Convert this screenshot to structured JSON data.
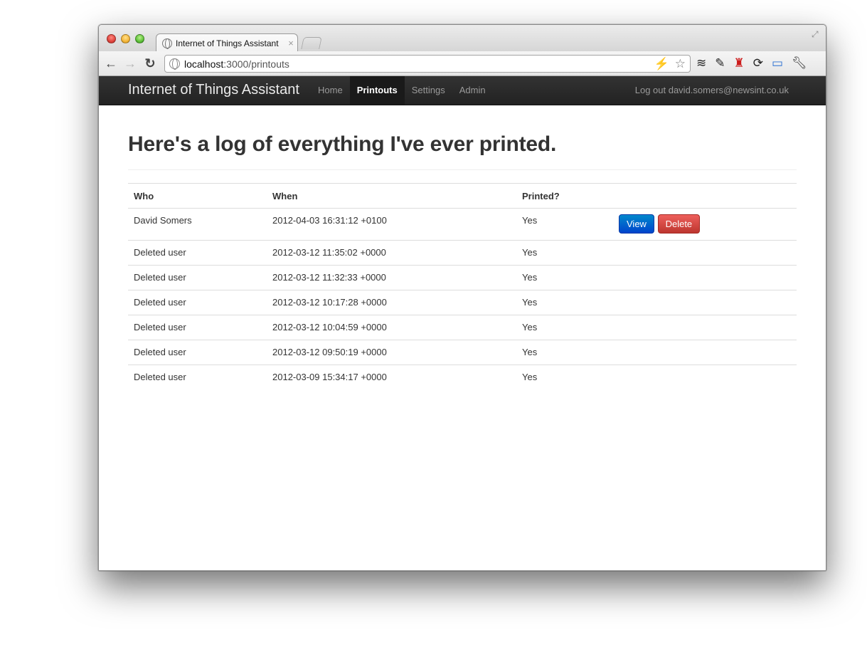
{
  "browser": {
    "tab_title": "Internet of Things Assistant",
    "tab_close": "×",
    "url_host": "localhost",
    "url_rest": ":3000/printouts"
  },
  "nav": {
    "brand": "Internet of Things Assistant",
    "links": [
      "Home",
      "Printouts",
      "Settings",
      "Admin"
    ],
    "active": "Printouts",
    "account": "Log out david.somers@newsint.co.uk"
  },
  "main": {
    "title": "Here's a log of everything I've ever printed."
  },
  "table": {
    "headers": [
      "Who",
      "When",
      "Printed?"
    ],
    "rows": [
      {
        "who": "David Somers",
        "when": "2012-04-03 16:31:12 +0100",
        "printed": "Yes",
        "view_label": "View",
        "delete_label": "Delete"
      },
      {
        "who": "Deleted user",
        "when": "2012-03-12 11:35:02 +0000",
        "printed": "Yes"
      },
      {
        "who": "Deleted user",
        "when": "2012-03-12 11:32:33 +0000",
        "printed": "Yes"
      },
      {
        "who": "Deleted user",
        "when": "2012-03-12 10:17:28 +0000",
        "printed": "Yes"
      },
      {
        "who": "Deleted user",
        "when": "2012-03-12 10:04:59 +0000",
        "printed": "Yes"
      },
      {
        "who": "Deleted user",
        "when": "2012-03-12 09:50:19 +0000",
        "printed": "Yes"
      },
      {
        "who": "Deleted user",
        "when": "2012-03-09 15:34:17 +0000",
        "printed": "Yes"
      }
    ]
  },
  "colors": {
    "navbar": "#222222",
    "view_button": "#0055cc",
    "delete_button": "#da4f49"
  }
}
